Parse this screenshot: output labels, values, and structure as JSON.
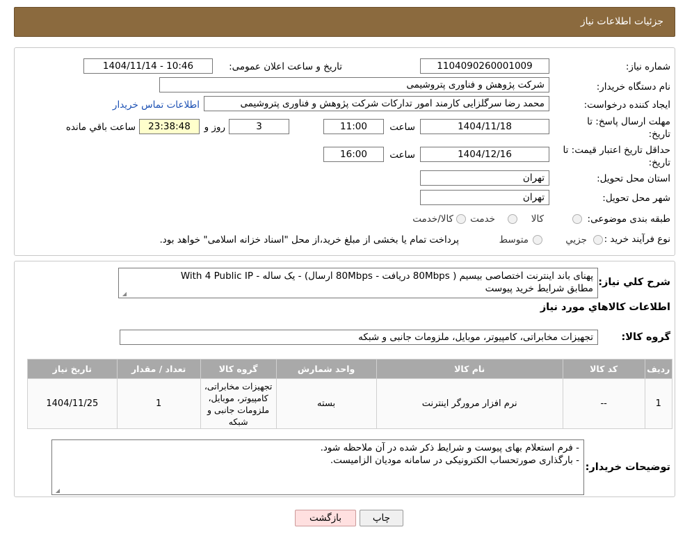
{
  "header": {
    "title": "جزئیات اطلاعات نیاز"
  },
  "fields": {
    "need_number_label": "شماره نیاز:",
    "need_number": "1104090260001009",
    "announce_label": "تاریخ و ساعت اعلان عمومی:",
    "announce_value": "1404/11/14 - 10:46",
    "buyer_org_label": "نام دستگاه خریدار:",
    "buyer_org": "شرکت پژوهش و فناوری پتروشیمی",
    "requester_label": "ایجاد کننده درخواست:",
    "requester": "محمد رضا سرگلزایی کارمند امور تدارکات شرکت پژوهش و فناوری پتروشیمی",
    "contact_link": "اطلاعات تماس خریدار",
    "deadline_label": "مهلت ارسال پاسخ: تا تاریخ:",
    "deadline_date": "1404/11/18",
    "time_label": "ساعت",
    "deadline_time": "11:00",
    "days": "3",
    "days_label": "روز و",
    "remaining_time": "23:38:48",
    "remaining_label": "ساعت باقي مانده",
    "validity_label": "حداقل تاریخ اعتبار قیمت: تا تاریخ:",
    "validity_date": "1404/12/16",
    "validity_time": "16:00",
    "province_label": "استان محل تحویل:",
    "province": "تهران",
    "city_label": "شهر محل تحویل:",
    "city": "تهران",
    "category_label": "طبقه بندی موضوعی:",
    "category_options": [
      "کالا",
      "خدمت",
      "کالا/خدمت"
    ],
    "process_label": "نوع فرآیند خرید :",
    "process_options": [
      "جزيي",
      "متوسط"
    ],
    "process_note": "پرداخت تمام یا بخشی از مبلغ خرید،از محل \"اسناد خزانه اسلامی\" خواهد بود."
  },
  "summary": {
    "label": "شرح کلي نیاز:",
    "line1": "پهنای باند اینترنت اختصاصی بیسیم ( 80Mbps دریافت - 80Mbps ارسال) - یک ساله - With 4 Public IP",
    "line2": "مطابق شرایط خرید پیوست"
  },
  "goods_info_title": "اطلاعات کالاهاي مورد نیاز",
  "goods_group": {
    "label": "گروه کالا:",
    "value": "تجهیزات مخابراتی، کامپیوتر، موبایل، ملزومات جانبی و شبکه"
  },
  "table": {
    "headers": [
      "رديف",
      "کد کالا",
      "نام کالا",
      "واحد شمارش",
      "گروه کالا",
      "تعداد / مقدار",
      "تاریخ نیاز"
    ],
    "rows": [
      [
        "1",
        "--",
        "نرم افزار مرورگر اینترنت",
        "بسته",
        "تجهیزات مخابراتی، کامپیوتر، موبایل، ملزومات جانبی و شبکه",
        "1",
        "1404/11/25"
      ]
    ]
  },
  "buyer_notes": {
    "label": "توضیحات خریدار:",
    "line1": "- فرم استعلام بهای پیوست و شرایط ذکر شده در آن ملاحظه شود.",
    "line2": "- بارگذاری صورتحساب الکترونیکی در سامانه مودیان الزامیست."
  },
  "buttons": {
    "print": "چاپ",
    "back": "بازگشت"
  },
  "watermark": {
    "text": "AriaTender.neT"
  },
  "colors": {
    "header_bg": "#8b6a3e",
    "table_header_bg": "#a9a9a9",
    "link": "#1a4fb3",
    "remaining_bg": "#ffffcc"
  }
}
